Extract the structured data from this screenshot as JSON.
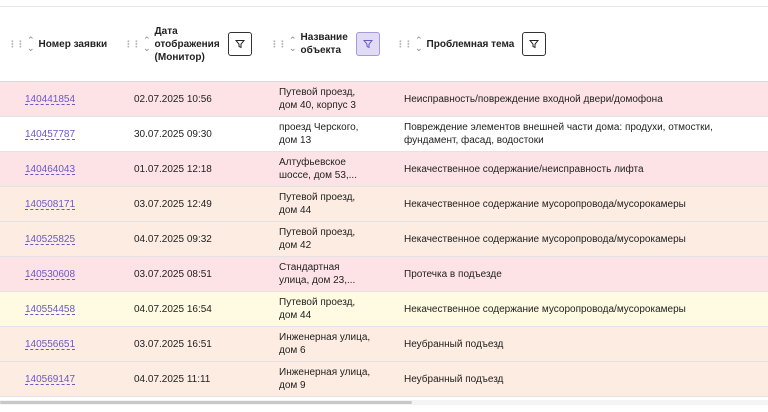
{
  "columns": {
    "number": "Номер заявки",
    "date_line1": "Дата",
    "date_line2": "отображения",
    "date_line3": "(Монитор)",
    "object_line1": "Название",
    "object_line2": "объекта",
    "topic": "Проблемная тема"
  },
  "icons": {
    "drag": "drag-handle-icon",
    "sort": "sort-icon",
    "filter": "filter-icon"
  },
  "colors": {
    "pink": "#fde3e6",
    "white": "#ffffff",
    "peach": "#fdece1",
    "yellow": "#fefbe2",
    "link": "#6a58c8",
    "filter_active": "#e2dbf6"
  },
  "rows": [
    {
      "number": "140441854",
      "date": "02.07.2025 10:56",
      "object_line1": "Путевой проезд,",
      "object_line2": "дом 40, корпус 3",
      "topic_line1": "Неисправность/повреждение входной двери/домофона",
      "topic_line2": ""
    },
    {
      "number": "140457787",
      "date": "30.07.2025 09:30",
      "object_line1": "проезд Черского,",
      "object_line2": "дом 13",
      "topic_line1": "Повреждение элементов внешней части дома: продухи, отмостки,",
      "topic_line2": "фундамент, фасад, водостоки"
    },
    {
      "number": "140464043",
      "date": "01.07.2025 12:18",
      "object_line1": "Алтуфьевское",
      "object_line2": "шоссе, дом 53,...",
      "topic_line1": "Некачественное содержание/неисправность лифта",
      "topic_line2": ""
    },
    {
      "number": "140508171",
      "date": "03.07.2025 12:49",
      "object_line1": "Путевой проезд,",
      "object_line2": "дом 44",
      "topic_line1": "Некачественное содержание мусоропровода/мусорокамеры",
      "topic_line2": ""
    },
    {
      "number": "140525825",
      "date": "04.07.2025 09:32",
      "object_line1": "Путевой проезд,",
      "object_line2": "дом 42",
      "topic_line1": "Некачественное содержание мусоропровода/мусорокамеры",
      "topic_line2": ""
    },
    {
      "number": "140530608",
      "date": "03.07.2025 08:51",
      "object_line1": "Стандартная",
      "object_line2": "улица, дом 23,...",
      "topic_line1": "Протечка в подъезде",
      "topic_line2": ""
    },
    {
      "number": "140554458",
      "date": "04.07.2025 16:54",
      "object_line1": "Путевой проезд,",
      "object_line2": "дом 44",
      "topic_line1": "Некачественное содержание мусоропровода/мусорокамеры",
      "topic_line2": ""
    },
    {
      "number": "140556651",
      "date": "03.07.2025 16:51",
      "object_line1": "Инженерная улица,",
      "object_line2": "дом 6",
      "topic_line1": "Неубранный подъезд",
      "topic_line2": ""
    },
    {
      "number": "140569147",
      "date": "04.07.2025 11:11",
      "object_line1": "Инженерная улица,",
      "object_line2": "дом 9",
      "topic_line1": "Неубранный подъезд",
      "topic_line2": ""
    }
  ]
}
